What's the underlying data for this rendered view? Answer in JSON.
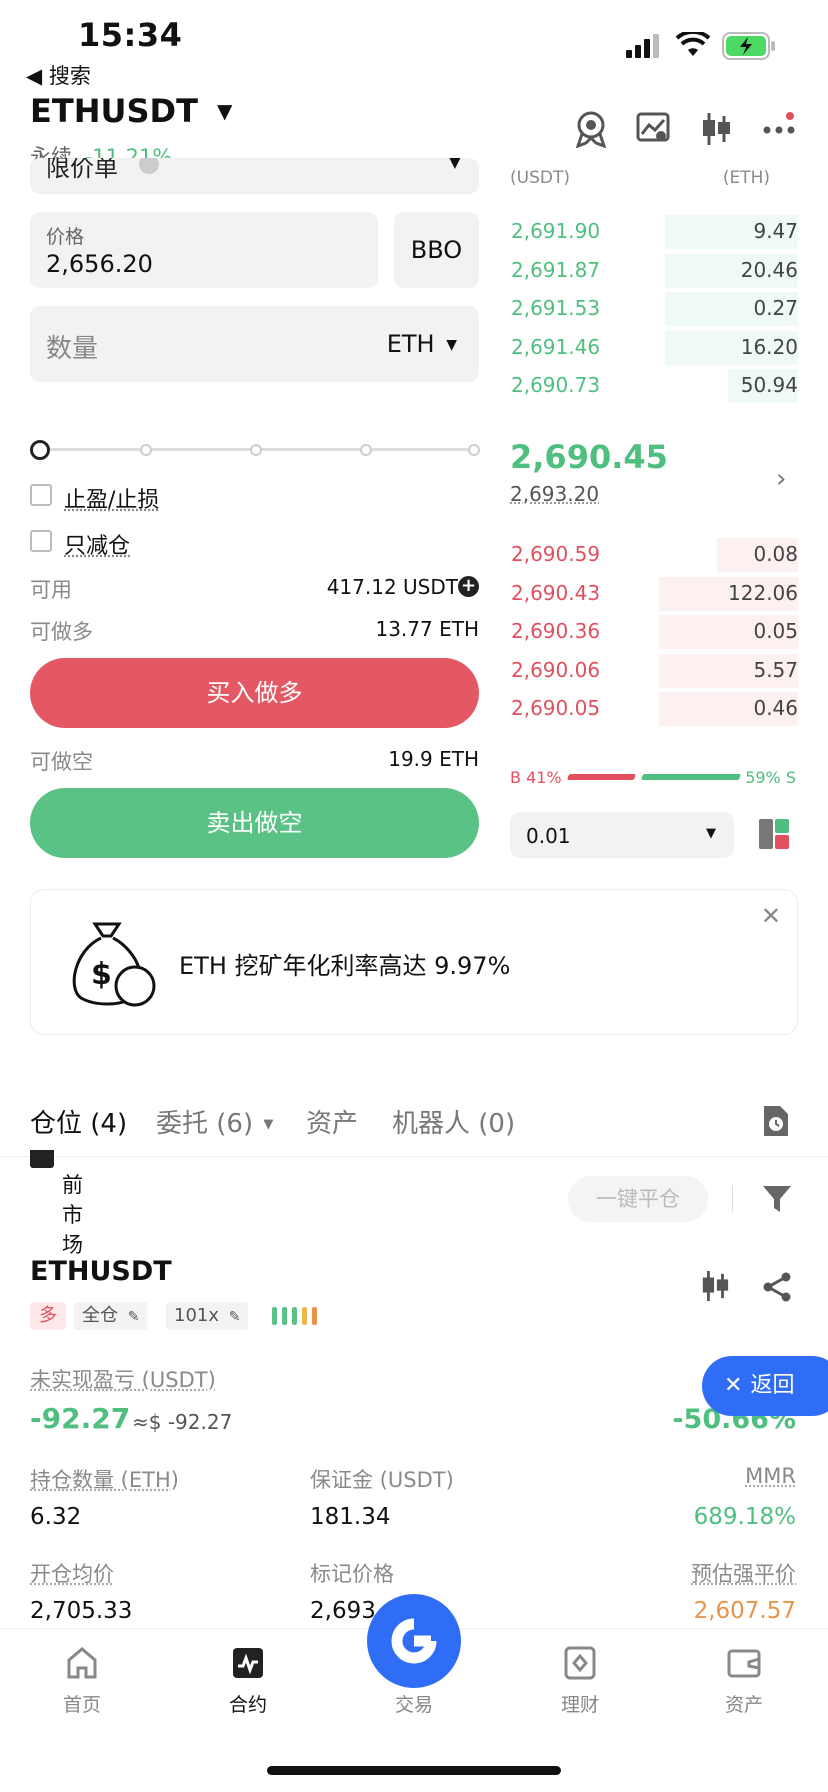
{
  "status": {
    "time": "15:34"
  },
  "nav_back": "◀ 搜索",
  "header": {
    "pair": "ETHUSDT",
    "perp_label": "永续",
    "change": "-11.21%"
  },
  "order_form": {
    "order_type": "限价单",
    "price_label": "价格",
    "price_value": "2,656.20",
    "bbo_label": "BBO",
    "qty_placeholder": "数量",
    "qty_unit": "ETH",
    "tp_sl_label": "止盈/止损",
    "reduce_only_label": "只减仓",
    "available_label": "可用",
    "available_value": "417.12 USDT",
    "can_long_label": "可做多",
    "can_long_value": "13.77 ETH",
    "buy_label": "买入做多",
    "can_short_label": "可做空",
    "can_short_value": "19.9 ETH",
    "sell_label": "卖出做空"
  },
  "orderbook": {
    "col_price": "(USDT)",
    "col_qty": "(ETH)",
    "asks": [
      {
        "price": "2,691.90",
        "qty": "9.47",
        "depth": 0.46
      },
      {
        "price": "2,691.87",
        "qty": "20.46",
        "depth": 0.46
      },
      {
        "price": "2,691.53",
        "qty": "0.27",
        "depth": 0.46
      },
      {
        "price": "2,691.46",
        "qty": "16.20",
        "depth": 0.46
      },
      {
        "price": "2,690.73",
        "qty": "50.94",
        "depth": 0.24
      }
    ],
    "last_price": "2,690.45",
    "mark_price": "2,693.20",
    "bids": [
      {
        "price": "2,690.59",
        "qty": "0.08",
        "depth": 0.28
      },
      {
        "price": "2,690.43",
        "qty": "122.06",
        "depth": 0.48
      },
      {
        "price": "2,690.36",
        "qty": "0.05",
        "depth": 0.48
      },
      {
        "price": "2,690.06",
        "qty": "5.57",
        "depth": 0.48
      },
      {
        "price": "2,690.05",
        "qty": "0.46",
        "depth": 0.48
      }
    ],
    "buy_ratio_label": "B 41%",
    "sell_ratio_label": "59% S",
    "buy_ratio": 0.41,
    "precision": "0.01"
  },
  "banner": {
    "text": "ETH 挖矿年化利率高达 9.97%"
  },
  "tabs": {
    "positions": "仓位 (4)",
    "orders": "委托 (6)",
    "assets": "资产",
    "bots": "机器人 (0)"
  },
  "positions": {
    "current_market_label": "前市场",
    "close_all": "一键平仓",
    "pair": "ETHUSDT",
    "side": "多",
    "margin_mode": "全仓",
    "leverage": "101x",
    "pnl_label": "未实现盈亏 (USDT)",
    "pnl_value": "-92.27",
    "pnl_usd": "≈$ -92.27",
    "roe": "-50.66%",
    "back_label": "返回",
    "size_label": "持仓数量 (ETH)",
    "size_value": "6.32",
    "margin_label": "保证金 (USDT)",
    "margin_value": "181.34",
    "mmr_label": "MMR",
    "mmr_value": "689.18%",
    "entry_label": "开仓均价",
    "entry_value": "2,705.33",
    "mark_label": "标记价格",
    "mark_value": "2,693",
    "liq_label": "预估强平价",
    "liq_value": "2,607.57"
  },
  "bottom_nav": {
    "home": "首页",
    "futures": "合约",
    "trade": "交易",
    "earn": "理财",
    "assets": "资产"
  },
  "colors": {
    "green": "#4fbf7f",
    "red": "#e1505d",
    "blue": "#2f6df6",
    "orange": "#e8944a"
  }
}
